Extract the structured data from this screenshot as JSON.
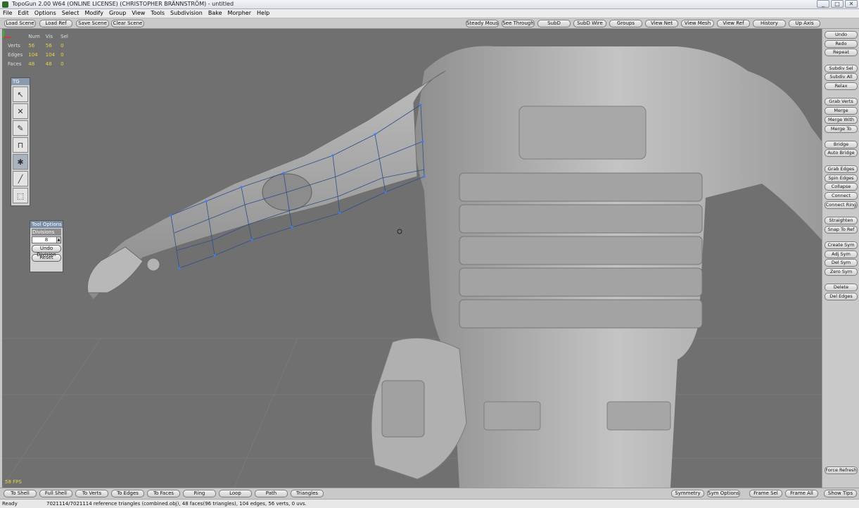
{
  "window": {
    "title": "TopoGun 2.00 W64  (ONLINE LICENSE) (CHRISTOPHER BRÄNNSTRÖM) - untitled",
    "minimize": "_",
    "maximize": "□",
    "close": "✕"
  },
  "menu": [
    "File",
    "Edit",
    "Options",
    "Select",
    "Modify",
    "Group",
    "View",
    "Tools",
    "Subdivision",
    "Bake",
    "Morpher",
    "Help"
  ],
  "toolbar_left": [
    "Load Scene",
    "Load Ref",
    "Save Scene",
    "Clear Scene"
  ],
  "toolbar_right": [
    "Steady Mouse",
    "See Through",
    "SubD",
    "SubD Wire",
    "Groups",
    "View Net",
    "View Mesh",
    "View Ref",
    "History",
    "Up Axis"
  ],
  "stats": {
    "headers": [
      "Num",
      "Vis",
      "Sel"
    ],
    "rows": [
      {
        "label": "Verts",
        "num": "56",
        "vis": "56",
        "sel": "0"
      },
      {
        "label": "Edges",
        "num": "104",
        "vis": "104",
        "sel": "0"
      },
      {
        "label": "Faces",
        "num": "48",
        "vis": "48",
        "sel": "0"
      }
    ]
  },
  "fps": "58 FPS",
  "tg_panel": {
    "title": "TG",
    "tools": [
      "create-tool-icon",
      "delete-tool-icon",
      "draw-tool-icon",
      "bridge-tool-icon",
      "brush-tool-icon",
      "edge-tool-icon",
      "select-box-icon"
    ]
  },
  "tool_options": {
    "title": "Tool Options",
    "divisions_label": "Divisions",
    "divisions_value": "8",
    "undo_label": "Undo Division",
    "reset_label": "Reset"
  },
  "right_panel": {
    "groups": [
      [
        "Undo",
        "Redo",
        "Repeat"
      ],
      [
        "Subdiv Sel",
        "Subdiv All",
        "Relax"
      ],
      [
        "Grab Verts",
        "Merge",
        "Merge With",
        "Merge To"
      ],
      [
        "Bridge",
        "Auto Bridge"
      ],
      [
        "Grab Edges",
        "Spin Edges",
        "Collapse",
        "Connect",
        "Connect Ring"
      ],
      [
        "Straighten",
        "Snap To Ref"
      ],
      [
        "Create Sym",
        "Adj Sym",
        "Del Sym",
        "Zero Sym"
      ],
      [
        "Delete",
        "Del Edges"
      ]
    ],
    "force_refresh": "Force Refresh",
    "show_tips": "Show Tips"
  },
  "bottom_left": [
    "To Shell",
    "Full Shell",
    "To Verts",
    "To Edges",
    "To Faces",
    "Ring",
    "Loop",
    "Path",
    "Triangles"
  ],
  "bottom_right": [
    "Symmetry",
    "Sym Options",
    "Frame Sel",
    "Frame All"
  ],
  "status": {
    "ready": "Ready",
    "message": "7021114/7021114 reference triangles (combined.obj), 48 faces(96 triangles), 104 edges, 56 verts, 0 uvs."
  },
  "colors": {
    "viewport_bg": "#707070",
    "mesh": "#b5b5b5",
    "stats_text": "#e8d24a",
    "retopo_verts": "#3a7dff"
  }
}
